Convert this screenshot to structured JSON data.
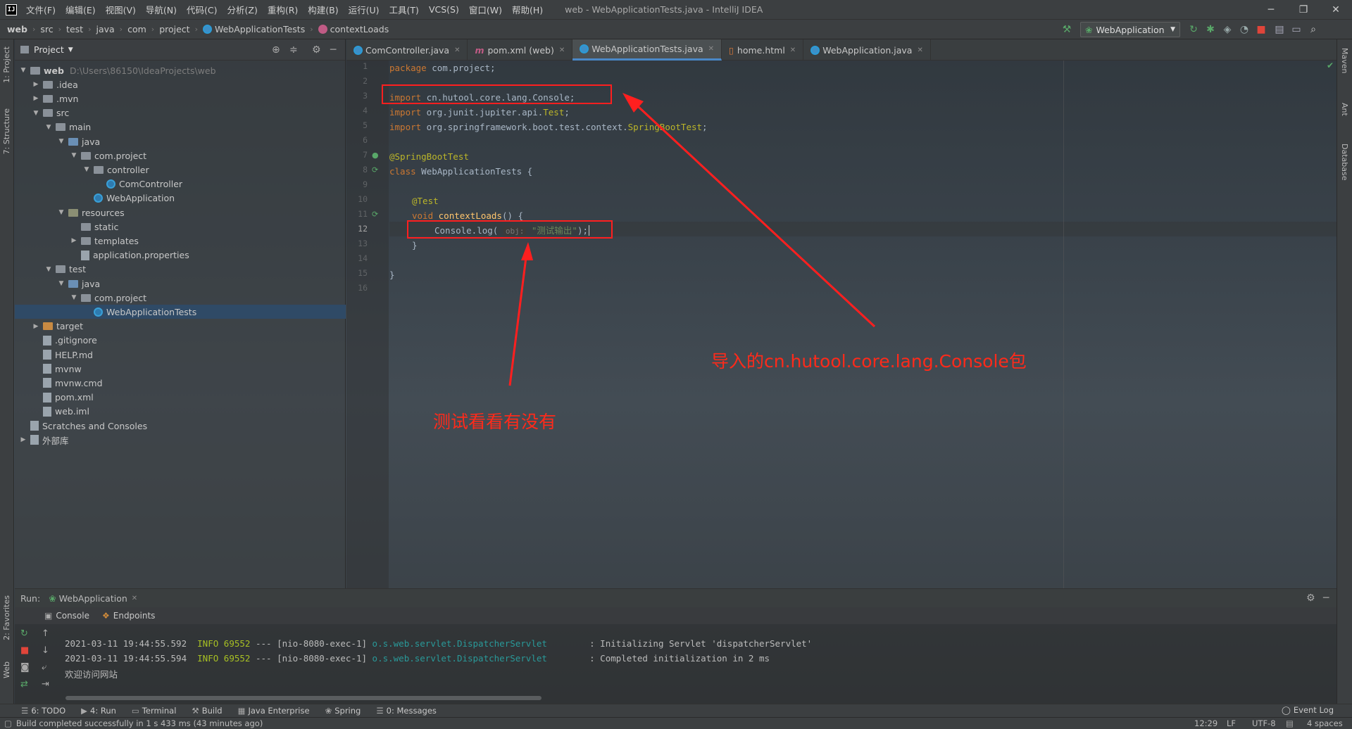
{
  "app": {
    "logo": "IJ",
    "window_title": "web - WebApplicationTests.java - IntelliJ IDEA"
  },
  "menu": [
    "文件(F)",
    "编辑(E)",
    "视图(V)",
    "导航(N)",
    "代码(C)",
    "分析(Z)",
    "重构(R)",
    "构建(B)",
    "运行(U)",
    "工具(T)",
    "VCS(S)",
    "窗口(W)",
    "帮助(H)"
  ],
  "window_controls": {
    "minimize": "─",
    "restore": "❐",
    "close": "✕"
  },
  "breadcrumb": [
    "web",
    "src",
    "test",
    "java",
    "com",
    "project",
    "WebApplicationTests",
    "contextLoads"
  ],
  "run_config": "WebApplication",
  "left_stripe": {
    "project": "1: Project",
    "structure": "7: Structure",
    "favorites": "2: Favorites",
    "web": "Web"
  },
  "right_stripe": {
    "maven": "Maven",
    "ant": "Ant",
    "database": "Database"
  },
  "project_panel": {
    "title": "Project",
    "tree": [
      {
        "label": "web",
        "path": "D:\\Users\\86150\\IdeaProjects\\web",
        "level": 0,
        "arrow": "▼",
        "type": "root"
      },
      {
        "label": ".idea",
        "level": 1,
        "arrow": "▶",
        "type": "folder"
      },
      {
        "label": ".mvn",
        "level": 1,
        "arrow": "▶",
        "type": "folder"
      },
      {
        "label": "src",
        "level": 1,
        "arrow": "▼",
        "type": "folder"
      },
      {
        "label": "main",
        "level": 2,
        "arrow": "▼",
        "type": "folder"
      },
      {
        "label": "java",
        "level": 3,
        "arrow": "▼",
        "type": "src"
      },
      {
        "label": "com.project",
        "level": 4,
        "arrow": "▼",
        "type": "folder"
      },
      {
        "label": "controller",
        "level": 5,
        "arrow": "▼",
        "type": "folder"
      },
      {
        "label": "ComController",
        "level": 6,
        "arrow": "",
        "type": "class"
      },
      {
        "label": "WebApplication",
        "level": 5,
        "arrow": "",
        "type": "class"
      },
      {
        "label": "resources",
        "level": 3,
        "arrow": "▼",
        "type": "res"
      },
      {
        "label": "static",
        "level": 4,
        "arrow": "",
        "type": "folder"
      },
      {
        "label": "templates",
        "level": 4,
        "arrow": "▶",
        "type": "folder"
      },
      {
        "label": "application.properties",
        "level": 4,
        "arrow": "",
        "type": "file"
      },
      {
        "label": "test",
        "level": 2,
        "arrow": "▼",
        "type": "folder"
      },
      {
        "label": "java",
        "level": 3,
        "arrow": "▼",
        "type": "src"
      },
      {
        "label": "com.project",
        "level": 4,
        "arrow": "▼",
        "type": "folder"
      },
      {
        "label": "WebApplicationTests",
        "level": 5,
        "arrow": "",
        "type": "class",
        "selected": true
      },
      {
        "label": "target",
        "level": 1,
        "arrow": "▶",
        "type": "orange"
      },
      {
        "label": ".gitignore",
        "level": 1,
        "arrow": "",
        "type": "file"
      },
      {
        "label": "HELP.md",
        "level": 1,
        "arrow": "",
        "type": "file"
      },
      {
        "label": "mvnw",
        "level": 1,
        "arrow": "",
        "type": "file"
      },
      {
        "label": "mvnw.cmd",
        "level": 1,
        "arrow": "",
        "type": "file"
      },
      {
        "label": "pom.xml",
        "level": 1,
        "arrow": "",
        "type": "file"
      },
      {
        "label": "web.iml",
        "level": 1,
        "arrow": "",
        "type": "file"
      },
      {
        "label": "Scratches and Consoles",
        "level": 0,
        "arrow": "",
        "type": "file"
      },
      {
        "label": "外部库",
        "level": 0,
        "arrow": "▶",
        "type": "file"
      }
    ]
  },
  "editor_tabs": [
    {
      "label": "ComController.java",
      "active": false,
      "icon": "class-icon"
    },
    {
      "label": "pom.xml (web)",
      "active": false,
      "icon": "maven-icon"
    },
    {
      "label": "WebApplicationTests.java",
      "active": true,
      "icon": "class-icon"
    },
    {
      "label": "home.html",
      "active": false,
      "icon": "html-icon"
    },
    {
      "label": "WebApplication.java",
      "active": false,
      "icon": "class-icon"
    }
  ],
  "code": {
    "current_line": 12,
    "l1_kw": "package",
    "l1_rest": " com.project;",
    "l3_kw": "import",
    "l3_rest": " cn.hutool.core.lang.Console;",
    "l4_kw": "import",
    "l4_rest": " org.junit.jupiter.api.",
    "l4_an": "Test",
    "l4_end": ";",
    "l5_kw": "import",
    "l5_rest": " org.springframework.boot.test.context.",
    "l5_an": "SpringBootTest",
    "l5_end": ";",
    "l7_an": "@SpringBootTest",
    "l8_kw": "class",
    "l8_rest": " WebApplicationTests {",
    "l10_an": "@Test",
    "l11_kw": "void",
    "l11_fn": "contextLoads",
    "l11_rest": "() {",
    "l12_a": "Console.log( ",
    "l12_hint": "obj:",
    "l12_str": "\"测试输出\"",
    "l12_end": ");",
    "l13": "}",
    "l15": "}"
  },
  "annotations": {
    "import_note": "导入的cn.hutool.core.lang.Console包",
    "test_note": "测试看看有没有"
  },
  "run_panel": {
    "label": "Run:",
    "config_tab": "WebApplication",
    "console_tab": "Console",
    "endpoints_tab": "Endpoints",
    "logs": [
      {
        "ts": "2021-03-11 19:44:55.592",
        "level": "INFO",
        "pid": "69552",
        "thread": "--- [nio-8080-exec-1]",
        "cls": "o.s.web.servlet.DispatcherServlet",
        "msg": ": Initializing Servlet 'dispatcherServlet'"
      },
      {
        "ts": "2021-03-11 19:44:55.594",
        "level": "INFO",
        "pid": "69552",
        "thread": "--- [nio-8080-exec-1]",
        "cls": "o.s.web.servlet.DispatcherServlet",
        "msg": ": Completed initialization in 2 ms"
      }
    ],
    "output": "欢迎访问网站"
  },
  "bottom_tabs": [
    "6: TODO",
    "4: Run",
    "Terminal",
    "Build",
    "Java Enterprise",
    "Spring",
    "0: Messages"
  ],
  "event_log": "Event Log",
  "status": {
    "message": "Build completed successfully in 1 s 433 ms (43 minutes ago)",
    "position": "12:29",
    "line_sep": "LF",
    "encoding": "UTF-8",
    "indent": "4 spaces"
  },
  "colors": {
    "accent": "#4a88c7",
    "annotation": "#ff1f1f",
    "keyword": "#cc7832",
    "annotation_code": "#bbb529",
    "string": "#6a8759"
  }
}
